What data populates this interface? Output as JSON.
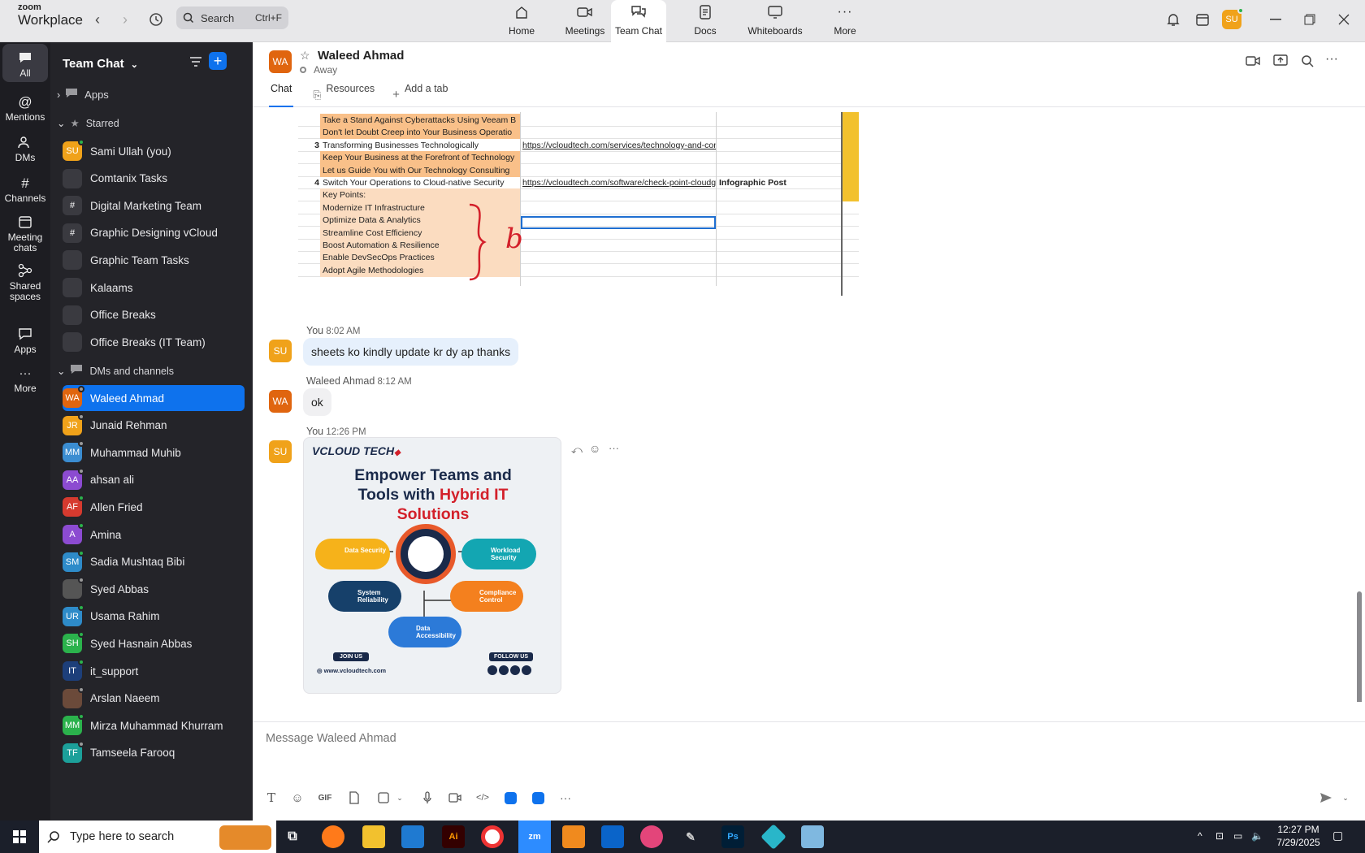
{
  "app": {
    "logo_top": "zoom",
    "logo_bottom": "Workplace"
  },
  "search": {
    "label": "Search",
    "shortcut": "Ctrl+F"
  },
  "top_tabs": [
    {
      "label": "Home",
      "icon": "home-icon"
    },
    {
      "label": "Meetings",
      "icon": "video-icon"
    },
    {
      "label": "Team Chat",
      "icon": "chat-icon"
    },
    {
      "label": "Docs",
      "icon": "doc-icon"
    },
    {
      "label": "Whiteboards",
      "icon": "whiteboard-icon"
    },
    {
      "label": "More",
      "icon": "more-icon"
    }
  ],
  "user_avatar": "SU",
  "rail": [
    {
      "label": "All"
    },
    {
      "label": "Mentions"
    },
    {
      "label": "DMs"
    },
    {
      "label": "Channels"
    },
    {
      "label": "Meeting chats"
    },
    {
      "label": "Shared spaces"
    },
    {
      "label": "Apps"
    },
    {
      "label": "More"
    }
  ],
  "sidebar": {
    "title": "Team Chat",
    "apps_label": "Apps",
    "starred_label": "Starred",
    "starred": [
      {
        "label": "Sami Ullah (you)",
        "initials": "SU",
        "color": "#f0a21a",
        "status": "#2bb24c"
      },
      {
        "label": "Comtanix Tasks",
        "initials": "",
        "color": "#3a3a40"
      },
      {
        "label": "Digital Marketing Team",
        "initials": "#",
        "color": "#3a3a40"
      },
      {
        "label": "Graphic Designing vCloud",
        "initials": "#",
        "color": "#3a3a40"
      },
      {
        "label": "Graphic Team Tasks",
        "initials": "",
        "color": "#3a3a40"
      },
      {
        "label": "Kalaams",
        "initials": "",
        "color": "#3a3a40"
      },
      {
        "label": "Office Breaks",
        "initials": "",
        "color": "#3a3a40"
      },
      {
        "label": "Office Breaks (IT Team)",
        "initials": "",
        "color": "#3a3a40"
      }
    ],
    "dms_label": "DMs and channels",
    "dms": [
      {
        "label": "Waleed Ahmad",
        "initials": "WA",
        "color": "#e0650f",
        "status": "#9a9a9a"
      },
      {
        "label": "Junaid Rehman",
        "initials": "JR",
        "color": "#f0a21a",
        "status": "#9a9a9a"
      },
      {
        "label": "Muhammad Muhib",
        "initials": "MM",
        "color": "#3b8dd1",
        "status": "#9a9a9a"
      },
      {
        "label": "ahsan ali",
        "initials": "AA",
        "color": "#8c4bd1",
        "status": "#9a9a9a"
      },
      {
        "label": "Allen Fried",
        "initials": "AF",
        "color": "#d63a2f",
        "status": "#2bb24c"
      },
      {
        "label": "Amina",
        "initials": "A",
        "color": "#8c4bd1",
        "status": "#2bb24c"
      },
      {
        "label": "Sadia Mushtaq Bibi",
        "initials": "SM",
        "color": "#2e8bc9",
        "status": "#2bb24c"
      },
      {
        "label": "Syed Abbas",
        "initials": "",
        "color": "#555",
        "status": "#9a9a9a"
      },
      {
        "label": "Usama Rahim",
        "initials": "UR",
        "color": "#2e8bc9",
        "status": "#2bb24c"
      },
      {
        "label": "Syed Hasnain Abbas",
        "initials": "SH",
        "color": "#2bb24c",
        "status": "#2bb24c"
      },
      {
        "label": "it_support",
        "initials": "IT",
        "color": "#1d3f7a",
        "status": "#2bb24c"
      },
      {
        "label": "Arslan Naeem",
        "initials": "",
        "color": "#6b4a3a",
        "status": "#9a9a9a"
      },
      {
        "label": "Mirza Muhammad Khurram",
        "initials": "MM",
        "color": "#2bb24c",
        "status": "#2bb24c"
      },
      {
        "label": "Tamseela Farooq",
        "initials": "TF",
        "color": "#1ca09a",
        "status": "#9a9a9a"
      }
    ]
  },
  "chat": {
    "name": "Waleed Ahmad",
    "initials": "WA",
    "status": "Away",
    "tabs": [
      "Chat",
      "Resources",
      "Add a tab"
    ]
  },
  "sheet_rows": [
    {
      "num": "",
      "text": "Take a Stand Against Cyberattacks Using Veeam B",
      "link": "",
      "type": "",
      "fill": "orange"
    },
    {
      "num": "",
      "text": "Don't let Doubt Creep into Your Business Operatio",
      "link": "",
      "type": "",
      "fill": "orange"
    },
    {
      "num": "3",
      "text": "Transforming Businesses Technologically",
      "link": "https://vcloudtech.com/services/technology-and-con",
      "type": "",
      "fill": ""
    },
    {
      "num": "",
      "text": "Keep Your Business at the Forefront of Technology",
      "link": "",
      "type": "",
      "fill": "orange"
    },
    {
      "num": "",
      "text": "Let us Guide You with Our Technology Consulting",
      "link": "",
      "type": "",
      "fill": "orange"
    },
    {
      "num": "4",
      "text": "Switch Your Operations to Cloud-native Security",
      "link": "https://vcloudtech.com/software/check-point-cloudg",
      "type": "Infographic Post",
      "fill": ""
    },
    {
      "num": "",
      "text": "Key Points:",
      "link": "",
      "type": "",
      "fill": "peach"
    },
    {
      "num": "",
      "text": "Modernize IT Infrastructure",
      "link": "",
      "type": "",
      "fill": "peach"
    },
    {
      "num": "",
      "text": "Optimize Data & Analytics",
      "link": "",
      "type": "",
      "fill": "peach"
    },
    {
      "num": "",
      "text": "Streamline Cost Efficiency",
      "link": "",
      "type": "",
      "fill": "peach"
    },
    {
      "num": "",
      "text": "Boost Automation & Resilience",
      "link": "",
      "type": "",
      "fill": "peach"
    },
    {
      "num": "",
      "text": "Enable DevSecOps Practices",
      "link": "",
      "type": "",
      "fill": "peach"
    },
    {
      "num": "",
      "text": "Adopt Agile Methodologies",
      "link": "",
      "type": "",
      "fill": "peach"
    }
  ],
  "annotation_letter": "b",
  "messages": [
    {
      "sender": "You",
      "time": "8:02 AM",
      "initials": "SU",
      "text": "sheets ko kindly update kr dy ap thanks"
    },
    {
      "sender": "Waleed Ahmad",
      "time": "8:12 AM",
      "initials": "WA",
      "text": "ok"
    },
    {
      "sender": "You",
      "time": "12:26 PM",
      "initials": "SU",
      "text": ""
    }
  ],
  "promo": {
    "brand": "VCLOUD TECH",
    "headline_1": "Empower Teams and",
    "headline_2a": "Tools with ",
    "headline_2b": "Hybrid IT",
    "headline_3": "Solutions",
    "pills": [
      "Data Security",
      "Workload Security",
      "System Reliability",
      "Compliance Control",
      "Data Accessibility"
    ],
    "join": "JOIN US",
    "follow": "FOLLOW US",
    "site": "www.vcloudtech.com"
  },
  "composer": {
    "placeholder": "Message Waleed Ahmad",
    "gif": "GIF"
  },
  "taskbar": {
    "search": "Type here to search",
    "time": "12:27 PM",
    "date": "7/29/2025",
    "zm": "zm",
    "ai": "Ai",
    "ps": "Ps"
  }
}
